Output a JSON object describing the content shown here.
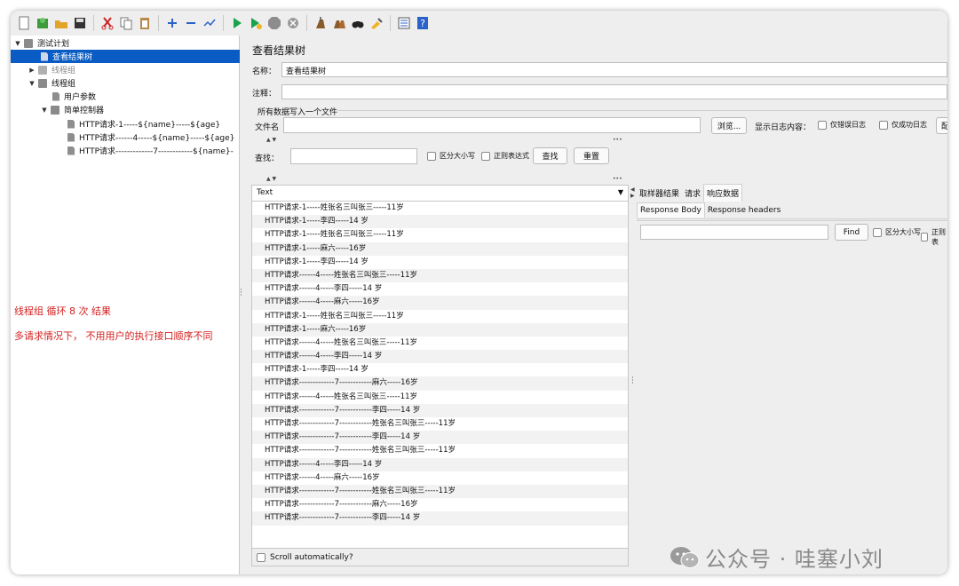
{
  "toolbar": {
    "icons": [
      "new-icon",
      "templates-icon",
      "open-icon",
      "save-icon",
      "cut-icon",
      "copy-icon",
      "paste-icon",
      "expand-icon",
      "collapse-icon",
      "toggle-icon",
      "start-icon",
      "start-no-pause-icon",
      "stop-icon",
      "shutdown-icon",
      "clear-icon",
      "clear-all-icon",
      "search-icon",
      "reset-search-icon",
      "function-helper-icon",
      "help-icon"
    ]
  },
  "tree": {
    "items": [
      {
        "label": "测试计划",
        "level": 0,
        "twisty": "▼",
        "icon": "folder"
      },
      {
        "label": "查看结果树",
        "level": 1,
        "twisty": "",
        "icon": "page",
        "selected": true
      },
      {
        "label": "线程组",
        "level": 1,
        "twisty": "▶",
        "icon": "folder",
        "dim": true
      },
      {
        "label": "线程组",
        "level": 1,
        "twisty": "▼",
        "icon": "folder"
      },
      {
        "label": "用户参数",
        "level": 2,
        "twisty": "",
        "icon": "page"
      },
      {
        "label": "简单控制器",
        "level": 2,
        "twisty": "▼",
        "icon": "folder"
      },
      {
        "label": "HTTP请求-1-----${name}-----${age}",
        "level": 3,
        "twisty": "",
        "icon": "page"
      },
      {
        "label": "HTTP请求------4-----${name}-----${age}",
        "level": 3,
        "twisty": "",
        "icon": "page"
      },
      {
        "label": "HTTP请求-------------7------------${name}-",
        "level": 3,
        "twisty": "",
        "icon": "page"
      }
    ],
    "note1": "线程组 循环  8  次 结果",
    "note2": "多请求情况下，  不用用户的执行接口顺序不同"
  },
  "panel": {
    "title": "查看结果树",
    "name_label": "名称：",
    "name_value": "查看结果树",
    "comment_label": "注释：",
    "comment_value": "",
    "section_label": "所有数据写入一个文件",
    "file_label": "文件名",
    "file_value": "",
    "browse_label": "浏览...",
    "log_label": "显示日志内容：",
    "errors_only": "仅错误日志",
    "success_only": "仅成功日志",
    "configure": "配置",
    "search_label": "查找：",
    "search_value": "",
    "case_sensitive": "区分大小写",
    "regex": "正则表达式",
    "find_btn": "查找",
    "reset_btn": "重置"
  },
  "results": {
    "renderer": "Text",
    "rows": [
      "HTTP请求-1-----姓张名三叫张三-----11岁",
      "HTTP请求-1-----李四-----14 岁",
      "HTTP请求-1-----姓张名三叫张三-----11岁",
      "HTTP请求-1-----麻六-----16岁",
      "HTTP请求-1-----李四-----14 岁",
      "HTTP请求------4-----姓张名三叫张三-----11岁",
      "HTTP请求------4-----李四-----14 岁",
      "HTTP请求------4-----麻六-----16岁",
      "HTTP请求-1-----姓张名三叫张三-----11岁",
      "HTTP请求-1-----麻六-----16岁",
      "HTTP请求------4-----姓张名三叫张三-----11岁",
      "HTTP请求------4-----李四-----14 岁",
      "HTTP请求-1-----李四-----14 岁",
      "HTTP请求-------------7------------麻六-----16岁",
      "HTTP请求------4-----姓张名三叫张三-----11岁",
      "HTTP请求-------------7------------李四-----14 岁",
      "HTTP请求-------------7------------姓张名三叫张三-----11岁",
      "HTTP请求-------------7------------李四-----14 岁",
      "HTTP请求-------------7------------姓张名三叫张三-----11岁",
      "HTTP请求------4-----李四-----14 岁",
      "HTTP请求------4-----麻六-----16岁",
      "HTTP请求-------------7------------姓张名三叫张三-----11岁",
      "HTTP请求-------------7------------麻六-----16岁",
      "HTTP请求-------------7------------李四-----14 岁"
    ],
    "scroll_auto": "Scroll automatically?"
  },
  "detail": {
    "tabs": [
      "取样器结果",
      "请求",
      "响应数据"
    ],
    "active_tab": 2,
    "subtabs": [
      "Response Body",
      "Response headers"
    ],
    "active_subtab": 0,
    "find_value": "",
    "find_btn": "Find",
    "case_sensitive": "区分大小写",
    "regex": "正则表"
  },
  "watermark": "公众号 · 哇塞小刘",
  "colors": {
    "selection": "#0a5cc4",
    "note": "#d42020",
    "play": "#1aa34a"
  }
}
